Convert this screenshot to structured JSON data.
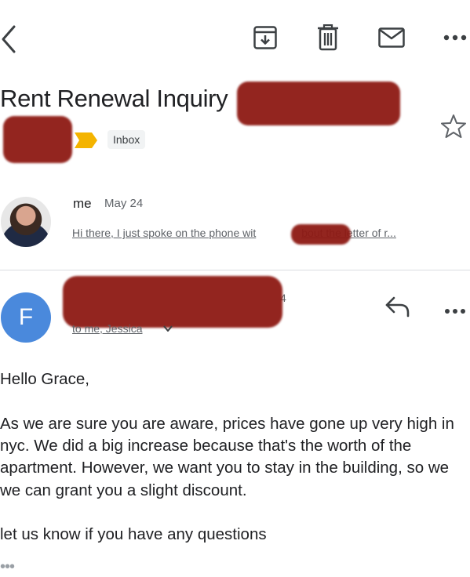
{
  "toolbar": {
    "back_icon": "chevron-left-icon",
    "archive_icon": "archive-icon",
    "delete_icon": "trash-icon",
    "mark_unread_icon": "envelope-icon",
    "more_icon": "more-horizontal-icon"
  },
  "thread": {
    "subject": "Rent Renewal Inquiry",
    "label": "Inbox",
    "star_icon": "star-outline-icon",
    "label_marker_color": "#f4b400"
  },
  "messages": [
    {
      "sender": "me",
      "date": "May 24",
      "snippet_start": "Hi there, I just spoke on the phone wit",
      "snippet_end": "bout the letter of r..."
    },
    {
      "avatar_letter": "F",
      "avatar_color": "#4a89dc",
      "recipients": "to me, Jessica",
      "date_fragment": "4",
      "body": [
        "Hello Grace,",
        "As we are sure you are aware, prices have gone up very high in nyc. We did a big increase because that's the worth of the apartment. However, we want you to stay in the building, so we we can grant you a slight discount.",
        "let us know if you have any questions"
      ],
      "trimmed_indicator": "•••"
    }
  ]
}
